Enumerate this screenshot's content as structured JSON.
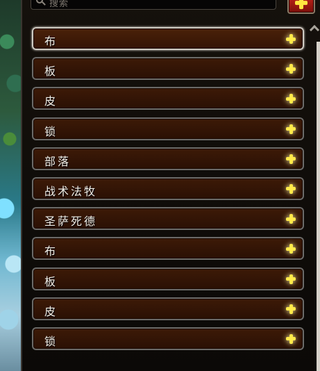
{
  "search": {
    "placeholder": "搜索"
  },
  "add_button": {
    "icon": "plus-icon",
    "color": "#c9261c"
  },
  "list": {
    "items": [
      {
        "label": "布",
        "selected": true
      },
      {
        "label": "板"
      },
      {
        "label": "皮"
      },
      {
        "label": "锁"
      },
      {
        "label": "部落"
      },
      {
        "label": "战术法牧"
      },
      {
        "label": "圣萨死德"
      },
      {
        "label": "布"
      },
      {
        "label": "板"
      },
      {
        "label": "皮"
      },
      {
        "label": "锁"
      }
    ]
  }
}
